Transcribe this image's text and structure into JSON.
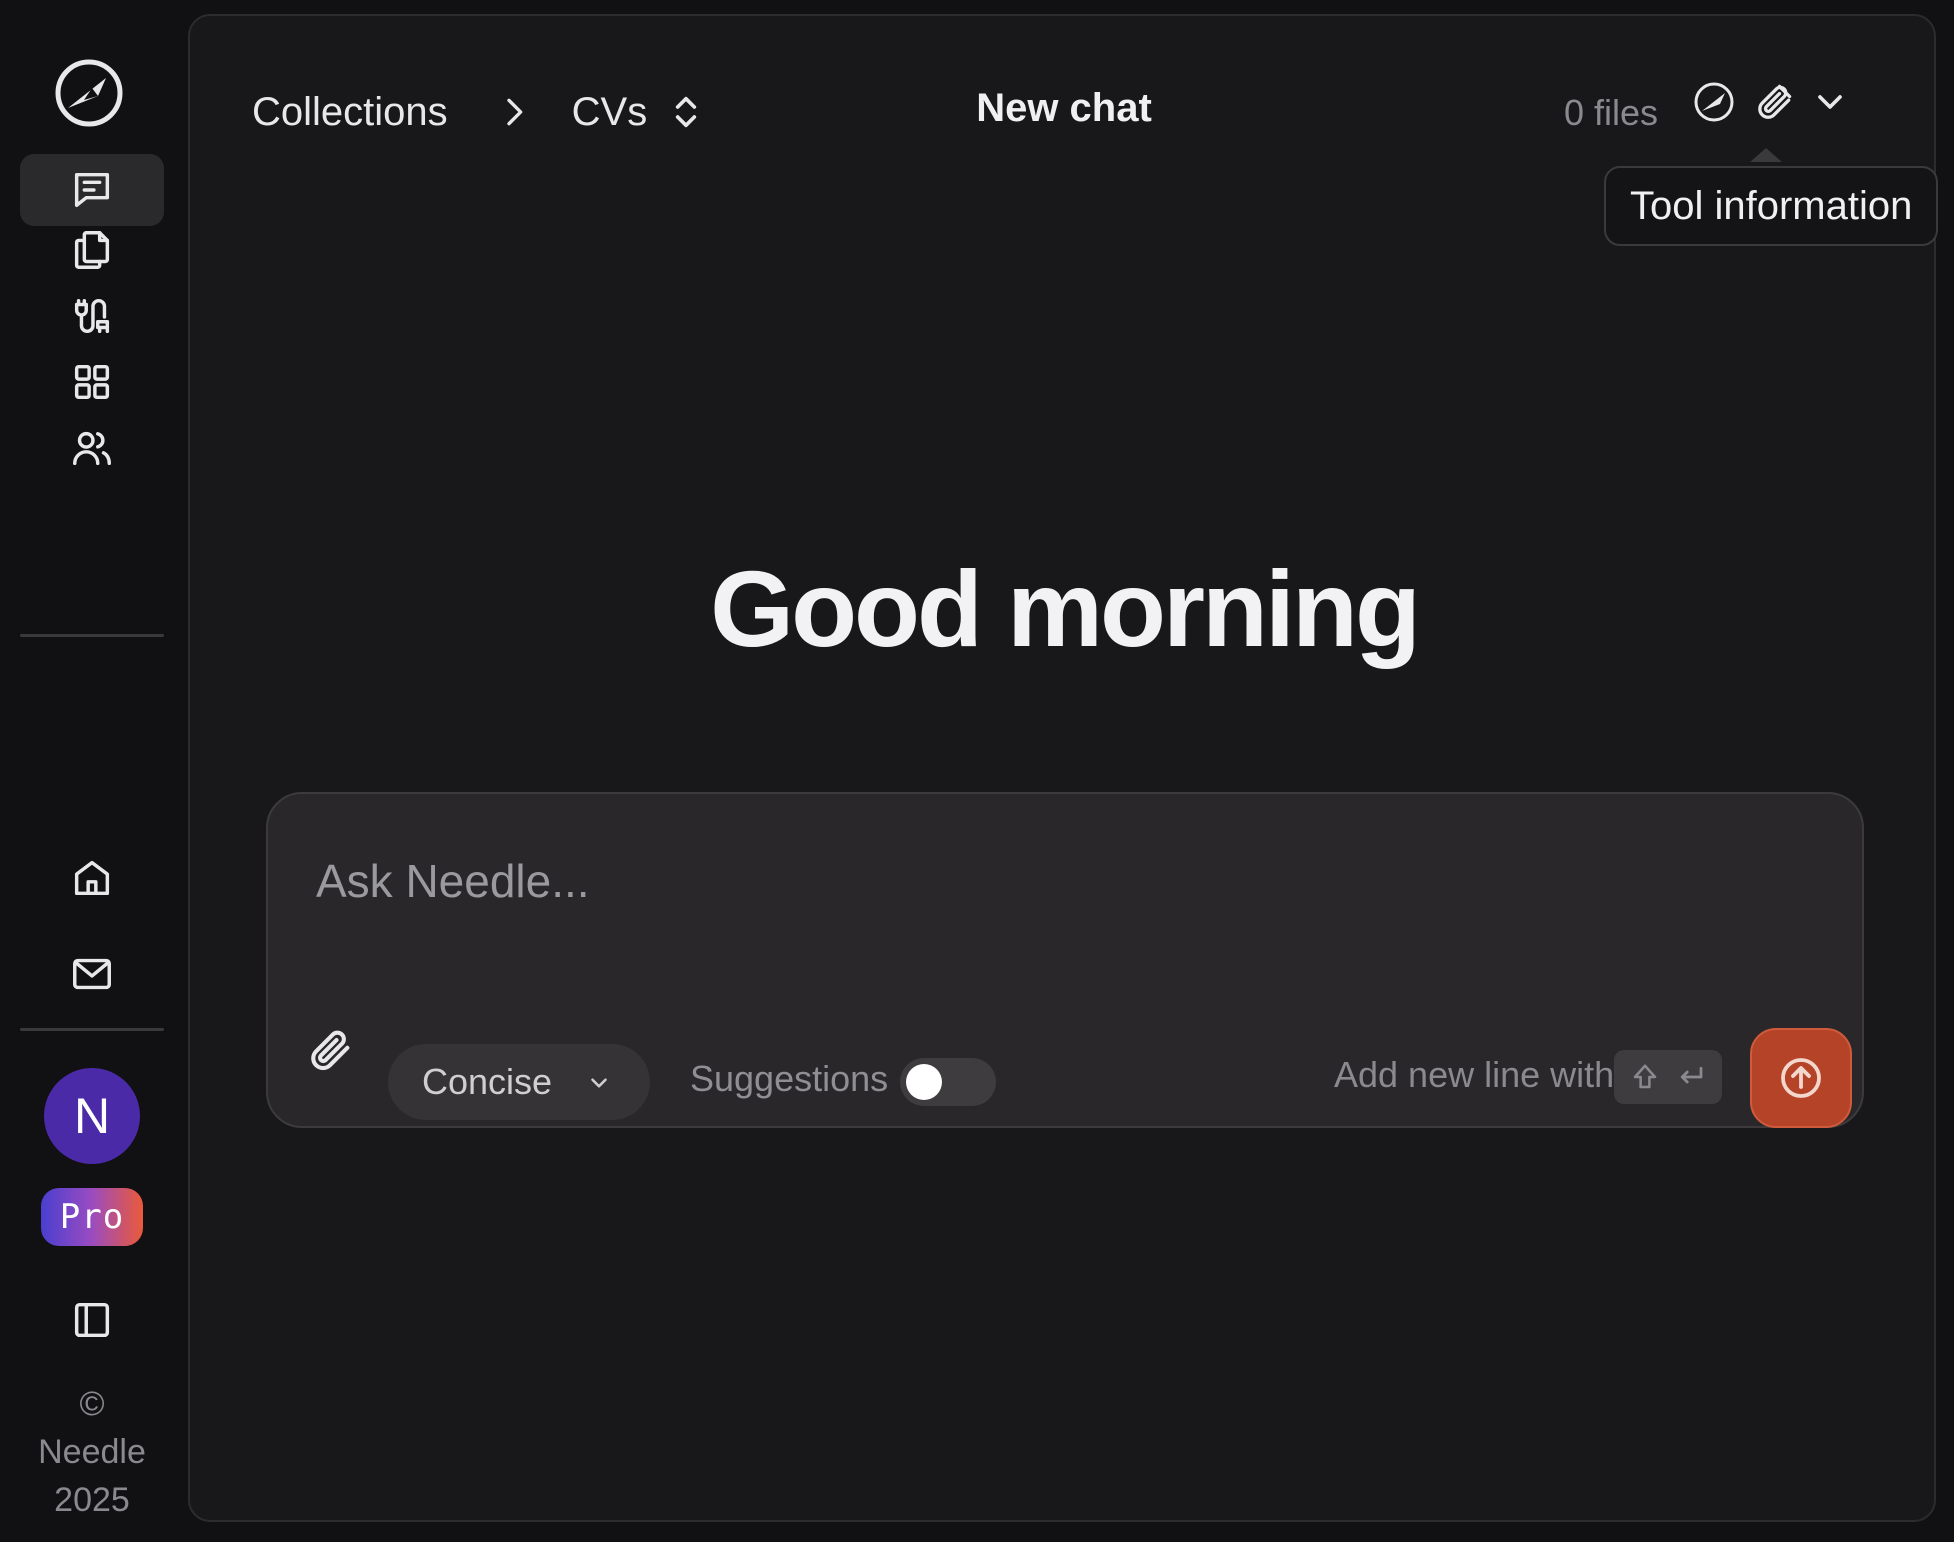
{
  "header": {
    "breadcrumb": {
      "root": "Collections",
      "current": "CVs"
    },
    "title": "New chat",
    "files_count": "0 files",
    "tooltip": "Tool information"
  },
  "main": {
    "greeting": "Good morning"
  },
  "composer": {
    "placeholder": "Ask Needle...",
    "mode": "Concise",
    "suggestions_label": "Suggestions",
    "suggestions_on": false,
    "hint": "Add new line with"
  },
  "sidebar": {
    "items": [
      {
        "icon": "chat-icon"
      },
      {
        "icon": "files-icon"
      },
      {
        "icon": "connectors-icon"
      },
      {
        "icon": "grid-icon"
      },
      {
        "icon": "users-icon"
      },
      {
        "icon": "home-icon"
      },
      {
        "icon": "mail-icon"
      }
    ],
    "avatar_initial": "N",
    "plan_badge": "Pro",
    "footer": {
      "copyright": "©",
      "brand": "Needle",
      "year": "2025"
    }
  },
  "colors": {
    "background": "#111113",
    "panel": "#18181a",
    "composer": "#29272a",
    "accent": "#b44328",
    "avatar": "#4b2aa8"
  }
}
